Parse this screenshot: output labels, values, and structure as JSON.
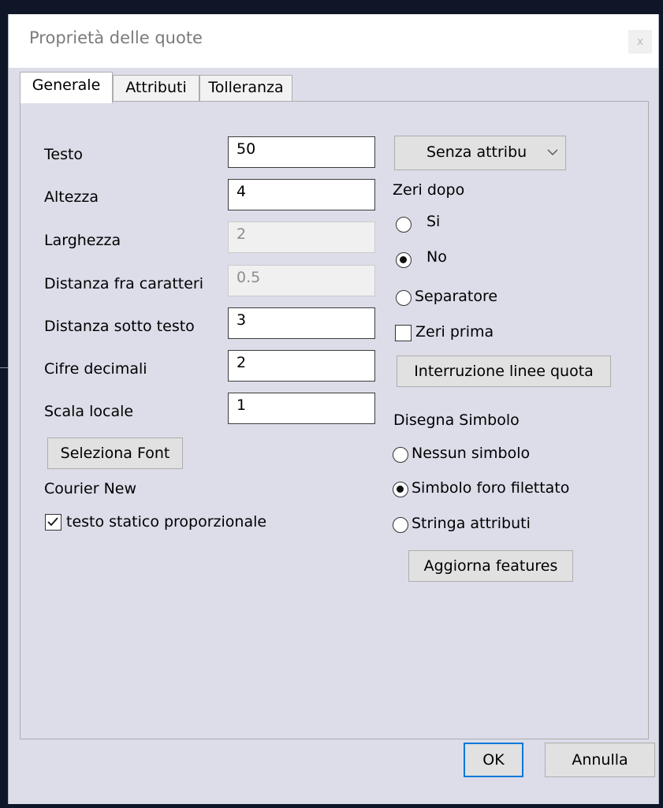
{
  "window": {
    "title": "Proprietà delle quote",
    "close_glyph": "x"
  },
  "tabs": [
    {
      "label": "Generale",
      "active": true
    },
    {
      "label": "Attributi",
      "active": false
    },
    {
      "label": "Tolleranza",
      "active": false
    }
  ],
  "general": {
    "fields": [
      {
        "label": "Testo",
        "value": "50",
        "enabled": true
      },
      {
        "label": "Altezza",
        "value": "4",
        "enabled": true
      },
      {
        "label": "Larghezza",
        "value": "2",
        "enabled": false
      },
      {
        "label": "Distanza fra caratteri",
        "value": "0.5",
        "enabled": false
      },
      {
        "label": "Distanza sotto testo",
        "value": "3",
        "enabled": true
      },
      {
        "label": "Cifre decimali",
        "value": "2",
        "enabled": true
      },
      {
        "label": "Scala locale",
        "value": "1",
        "enabled": true
      }
    ],
    "select_font_button": "Seleziona Font",
    "font_name": "Courier New",
    "proportional_checkbox": {
      "label": "testo statico proporzionale",
      "checked": true
    }
  },
  "right": {
    "attribute_select": {
      "value": "Senza attribu",
      "icon": "chevron-down-icon"
    },
    "zeros_after": {
      "title": "Zeri dopo",
      "options": [
        {
          "label": "Si",
          "checked": false
        },
        {
          "label": "No",
          "checked": true
        },
        {
          "label": "Separatore",
          "checked": false
        }
      ]
    },
    "zeros_before_checkbox": {
      "label": "Zeri prima",
      "checked": false
    },
    "dimension_break_button": "Interruzione linee quota",
    "draw_symbol": {
      "title": "Disegna Simbolo",
      "options": [
        {
          "label": "Nessun simbolo",
          "checked": false
        },
        {
          "label": "Simbolo foro filettato",
          "checked": true
        },
        {
          "label": "Stringa attributi",
          "checked": false
        }
      ]
    },
    "update_features_button": "Aggiorna features"
  },
  "footer": {
    "ok_label": "OK",
    "cancel_label": "Annulla"
  },
  "colors": {
    "dialog_background": "#dcdde9",
    "desktop_background": "#0e1627",
    "button_face": "#e1e1e1",
    "focus_border": "#0078d7"
  }
}
